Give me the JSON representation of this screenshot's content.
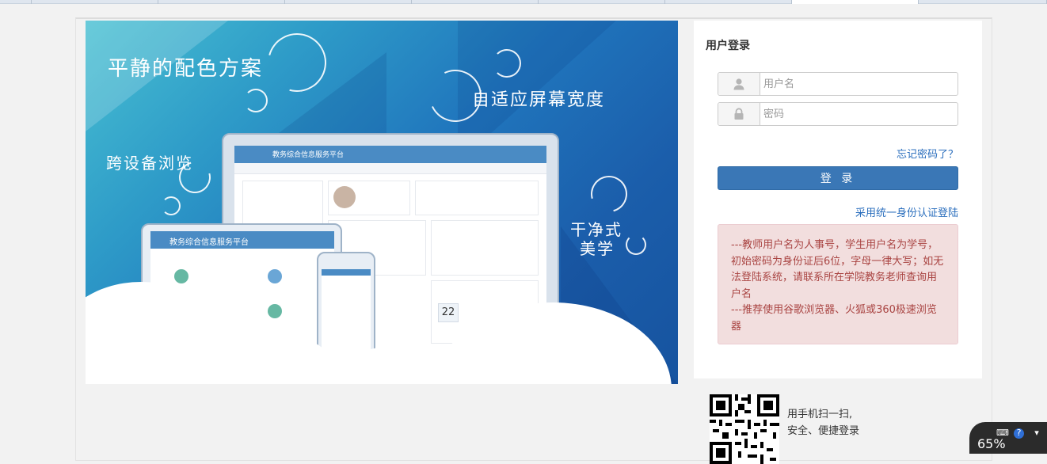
{
  "banner": {
    "slogans": [
      "平静的配色方案",
      "自适应屏幕宽度",
      "跨设备浏览",
      "干净式",
      "美学"
    ],
    "device_title": "教务综合信息服务平台",
    "date_number": "22"
  },
  "login": {
    "title": "用户登录",
    "username_placeholder": "用户名",
    "password_placeholder": "密码",
    "forgot_link": "忘记密码了？",
    "login_button": "登 录",
    "sso_link": "采用统一身份认证登陆",
    "notice_lines": [
      "---教师用户名为人事号，学生用户名为学号，初始密码为身份证后6位，字母一律大写；如无法登陆系统，请联系所在学院教务老师查询用户名",
      "---推荐使用谷歌浏览器、火狐或360极速浏览器"
    ]
  },
  "qr": {
    "line1": "用手机扫一扫,",
    "line2": "安全、便捷登录"
  },
  "tray_widget": {
    "percent": "65%"
  },
  "colors": {
    "primary_button": "#3a77b6",
    "link": "#2a6ebd",
    "notice_bg": "#f2dede",
    "notice_text": "#a94442"
  },
  "icons": [
    "user-icon",
    "lock-icon",
    "qr-code",
    "keyboard-icon",
    "help-icon"
  ]
}
